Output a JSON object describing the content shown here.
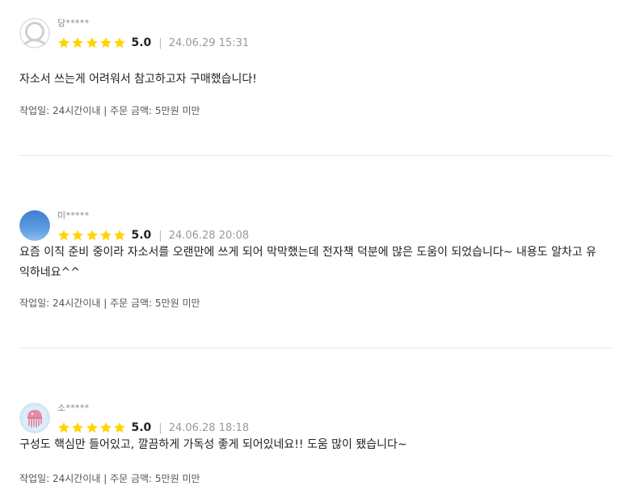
{
  "reviews": [
    {
      "author": "당*****",
      "avatar": "default-profile-icon",
      "rating_score": "5.0",
      "stars": 5,
      "separator": "|",
      "date": "24.06.29 15:31",
      "content": "자소서 쓰는게 어려워서 참고하고자 구매했습니다!",
      "info": "작업일: 24시간이내 | 주문 금액: 5만원 미만"
    },
    {
      "author": "미*****",
      "avatar": "blue-gradient-avatar",
      "rating_score": "5.0",
      "stars": 5,
      "separator": "|",
      "date": "24.06.28 20:08",
      "content": "요즘 이직 준비 중이라 자소서를 오랜만에 쓰게 되어 막막했는데 전자책 덕분에 많은 도움이 되었습니다~ 내용도 알차고 유익하네요^^",
      "info": "작업일: 24시간이내 | 주문 금액: 5만원 미만"
    },
    {
      "author": "소*****",
      "avatar": "jellyfish-avatar",
      "rating_score": "5.0",
      "stars": 5,
      "separator": "|",
      "date": "24.06.28 18:18",
      "content": "구성도 핵심만 들어있고, 깔끔하게 가독성 좋게 되어있네요!! 도움 많이 됐습니다~",
      "info": "작업일: 24시간이내 | 주문 금액: 5만원 미만"
    }
  ],
  "colors": {
    "star": "#FFD400",
    "text": "#222222",
    "muted": "#999999",
    "divider": "#e6e6e6"
  }
}
